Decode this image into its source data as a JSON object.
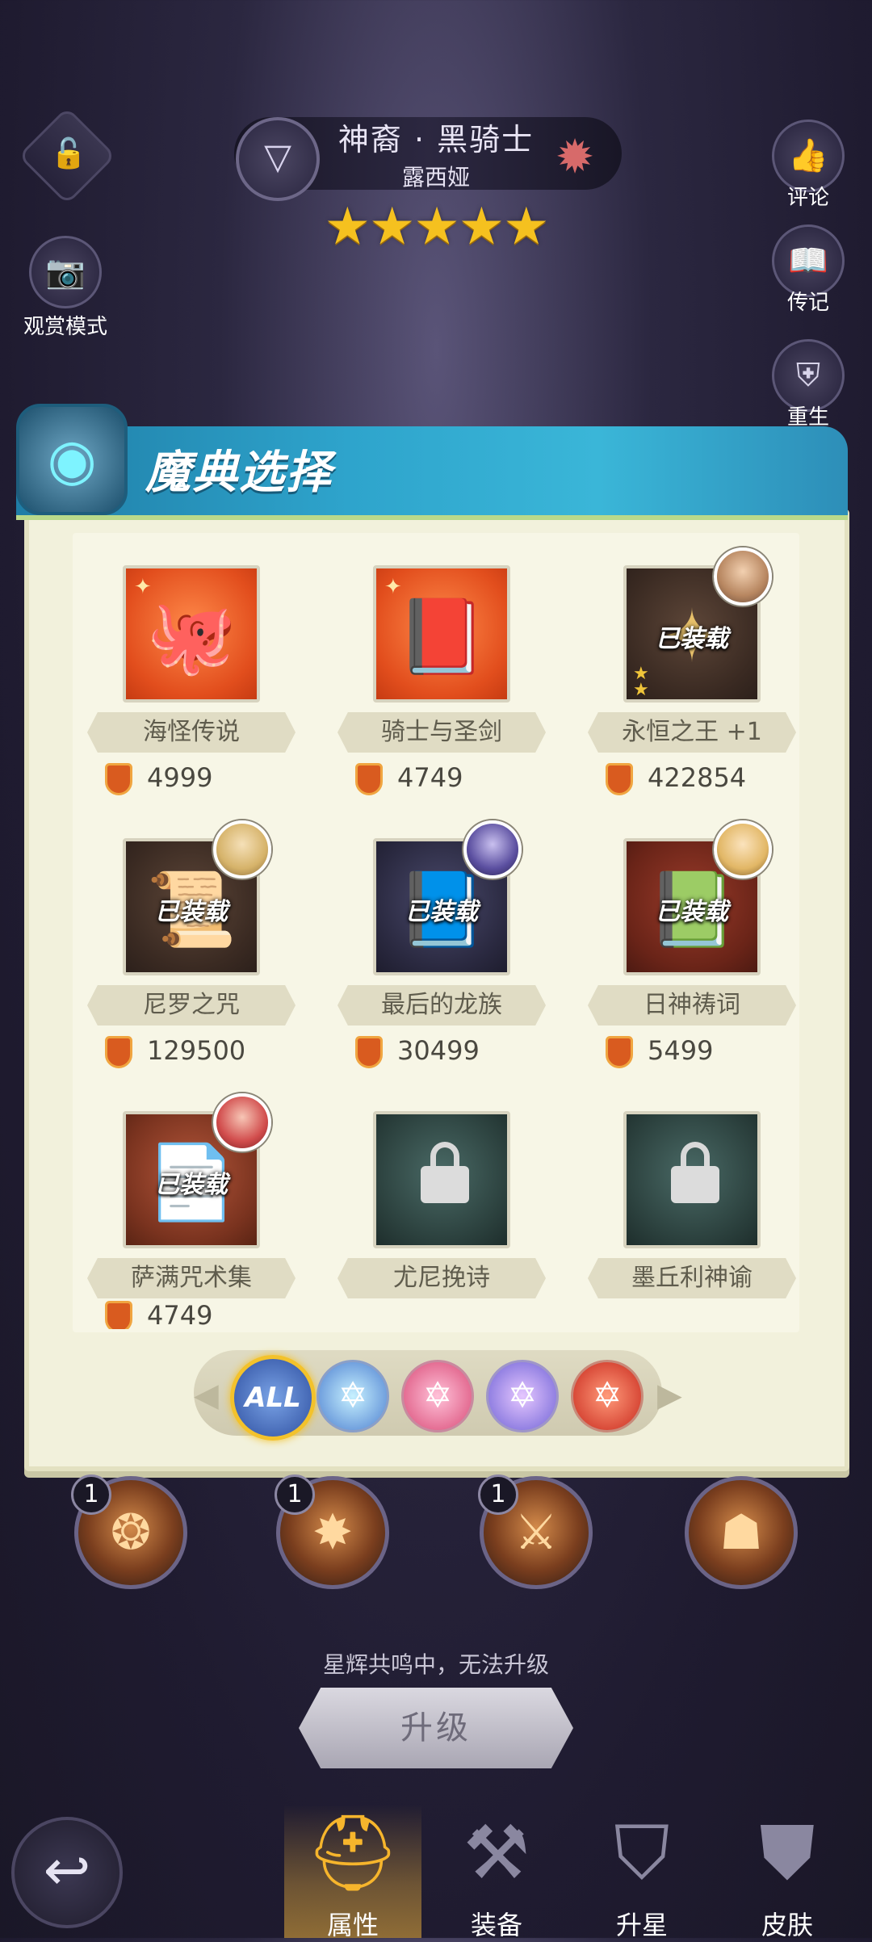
{
  "header": {
    "hero_title": "神裔 · 黑骑士",
    "hero_name": "露西娅",
    "stars": "★★★★★",
    "lock_icon": "🔓",
    "class_icon": "▽",
    "faction_icon": "✹"
  },
  "left_buttons": {
    "view_mode_label": "观赏模式",
    "camera_icon": "📷"
  },
  "right_buttons": [
    {
      "label": "评论",
      "icon": "👍"
    },
    {
      "label": "传记",
      "icon": "📖"
    },
    {
      "label": "重生",
      "icon": "⛨"
    }
  ],
  "panel": {
    "title": "魔典选择",
    "icon": "◉",
    "equipped_text": "已装载",
    "items": [
      {
        "name": "海怪传说",
        "price": "4999",
        "art": "🐙",
        "equipped": false,
        "locked": false
      },
      {
        "name": "骑士与圣剑",
        "price": "4749",
        "art": "📕",
        "equipped": false,
        "locked": false
      },
      {
        "name": "永恒之王 +1",
        "price": "422854",
        "art": "✦",
        "equipped": true,
        "locked": false
      },
      {
        "name": "尼罗之咒",
        "price": "129500",
        "art": "📜",
        "equipped": true,
        "locked": false
      },
      {
        "name": "最后的龙族",
        "price": "30499",
        "art": "📘",
        "equipped": true,
        "locked": false
      },
      {
        "name": "日神祷词",
        "price": "5499",
        "art": "📗",
        "equipped": true,
        "locked": false
      },
      {
        "name": "萨满咒术集",
        "price": "4749",
        "art": "📄",
        "equipped": true,
        "locked": false
      },
      {
        "name": "尤尼挽诗",
        "price": "",
        "art": "",
        "equipped": false,
        "locked": true
      },
      {
        "name": "墨丘利神谕",
        "price": "",
        "art": "",
        "equipped": false,
        "locked": true
      }
    ],
    "filters": {
      "all": "ALL",
      "star_icon": "✡"
    }
  },
  "skills": [
    {
      "level": "1",
      "icon": "❂"
    },
    {
      "level": "1",
      "icon": "✸"
    },
    {
      "level": "1",
      "icon": "⚔"
    },
    {
      "level": "",
      "icon": "☗"
    }
  ],
  "upgrade": {
    "note": "星辉共鸣中，无法升级",
    "button": "升级"
  },
  "nav": {
    "back_icon": "↩",
    "items": [
      {
        "label": "属性",
        "icon": "⛑"
      },
      {
        "label": "装备",
        "icon": "⚒"
      },
      {
        "label": "升星",
        "icon": "⛉"
      },
      {
        "label": "皮肤",
        "icon": "⛊"
      }
    ]
  }
}
